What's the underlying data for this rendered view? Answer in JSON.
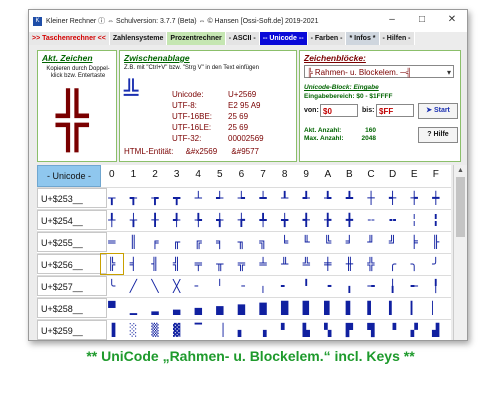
{
  "window": {
    "title": "Kleiner Rechner ⓘ  ⇔  Schulversion: 3.7.7  (Beta)   ⇔  © Hansen  [Ossi-Soft.de]  2019-2021",
    "controls": [
      "–",
      "□",
      "✕"
    ]
  },
  "menu": [
    ">> Taschenrechner <<",
    "Zahlensysteme",
    "Prozentrechner",
    "- ASCII -",
    "-- Unicode --",
    "- Farben -",
    "* Infos *",
    "- Hilfen -"
  ],
  "akt": {
    "title": "Akt. Zeichen",
    "hint": "Kopieren durch Doppel-klick bzw.  Entertaste",
    "char": "╬"
  },
  "clip": {
    "title": "Zwischenablage",
    "hint": "Z.B. mit  \"Ctrl+V\" bzw.  \"Strg V\" in den Text einfügen",
    "char": "╩",
    "labels": [
      "Unicode:",
      "UTF-8:",
      "UTF-16BE:",
      "UTF-16LE:",
      "UTF-32:"
    ],
    "values": [
      "U+2569",
      "E2 95 A9",
      "25 69",
      "25 69",
      "00002569"
    ],
    "entity_label": "HTML-Entität:",
    "entity_hex": "&#x2569",
    "entity_dec": "&#9577"
  },
  "blocks": {
    "title": "Zeichenblöcke:",
    "selected": "╠ Rahmen- u. Blockelem. ─╣",
    "unicode_block_label": "Unicode-Block: Eingabe",
    "range_label": "Eingabebereich: $0 - $1FFFF",
    "von_label": "von:",
    "von_value": "$0",
    "bis_label": "bis:",
    "bis_value": "$FF",
    "start_label": "Start",
    "akt_count_label": "Akt. Anzahl:",
    "akt_count": "160",
    "max_count_label": "Max. Anzahl:",
    "max_count": "2048",
    "help_label": "Hilfe"
  },
  "table": {
    "header": "- Unicode -",
    "columns": [
      "0",
      "1",
      "2",
      "3",
      "4",
      "5",
      "6",
      "7",
      "8",
      "9",
      "A",
      "B",
      "C",
      "D",
      "E",
      "F"
    ],
    "rows": [
      {
        "label": "U+$253__",
        "glyphs": [
          "┰",
          "┱",
          "┲",
          "┳",
          "┴",
          "┵",
          "┶",
          "┷",
          "┸",
          "┹",
          "┺",
          "┻",
          "┼",
          "┽",
          "┾",
          "┿"
        ]
      },
      {
        "label": "U+$254__",
        "glyphs": [
          "╀",
          "╁",
          "╂",
          "╃",
          "╄",
          "╅",
          "╆",
          "╇",
          "╈",
          "╉",
          "╊",
          "╋",
          "╌",
          "╍",
          "╎",
          "╏"
        ]
      },
      {
        "label": "U+$255__",
        "glyphs": [
          "═",
          "║",
          "╒",
          "╓",
          "╔",
          "╕",
          "╖",
          "╗",
          "╘",
          "╙",
          "╚",
          "╛",
          "╜",
          "╝",
          "╞",
          "╟"
        ]
      },
      {
        "label": "U+$256__",
        "glyphs": [
          "╠",
          "╡",
          "╢",
          "╣",
          "╤",
          "╥",
          "╦",
          "╧",
          "╨",
          "╩",
          "╪",
          "╫",
          "╬",
          "╭",
          "╮",
          "╯"
        ]
      },
      {
        "label": "U+$257__",
        "glyphs": [
          "╰",
          "╱",
          "╲",
          "╳",
          "╴",
          "╵",
          "╶",
          "╷",
          "╸",
          "╹",
          "╺",
          "╻",
          "╼",
          "╽",
          "╾",
          "╿"
        ]
      },
      {
        "label": "U+$258__",
        "glyphs": [
          "▀",
          "▁",
          "▂",
          "▃",
          "▄",
          "▅",
          "▆",
          "▇",
          "█",
          "▉",
          "▊",
          "▋",
          "▌",
          "▍",
          "▎",
          "▏"
        ]
      },
      {
        "label": "U+$259__",
        "glyphs": [
          "▐",
          "░",
          "▒",
          "▓",
          "▔",
          "▕",
          "▖",
          "▗",
          "▘",
          "▙",
          "▚",
          "▛",
          "▜",
          "▝",
          "▞",
          "▟"
        ]
      }
    ]
  },
  "caption": "**  UniCode „Rahmen- u. Blockelem.“ incl. Keys  **"
}
